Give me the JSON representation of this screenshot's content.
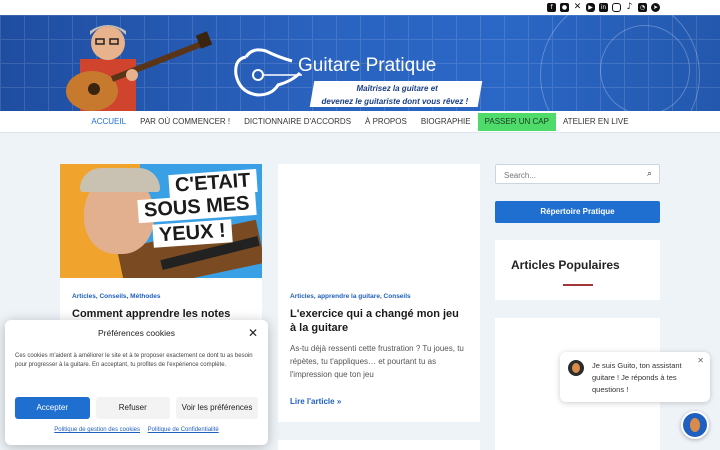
{
  "social": {
    "icons": [
      "facebook-icon",
      "users-icon",
      "x-icon",
      "youtube-icon",
      "linkedin-icon",
      "instagram-icon",
      "tiktok-icon",
      "rss-icon",
      "telegram-icon"
    ]
  },
  "header": {
    "brand": "Guitare Pratique",
    "tagline_line1": "Maîtrisez la guitare et",
    "tagline_line2": "devenez le guitariste dont vous rêvez !"
  },
  "nav": {
    "items": [
      {
        "label": "ACCUEIL"
      },
      {
        "label": "PAR OÙ COMMENCER !"
      },
      {
        "label": "DICTIONNAIRE D'ACCORDS"
      },
      {
        "label": "À PROPOS"
      },
      {
        "label": "BIOGRAPHIE"
      },
      {
        "label": "PASSER UN CAP"
      },
      {
        "label": "ATELIER EN LIVE"
      }
    ]
  },
  "posts": [
    {
      "thumb_line1": "C'ETAIT",
      "thumb_line2": "SOUS MES",
      "thumb_line3": "YEUX !",
      "categories": "Articles, Conseils, Méthodes",
      "title": "Comment apprendre les notes sur"
    },
    {
      "categories": "Articles, apprendre la guitare, Conseils",
      "title": "L'exercice qui a changé mon jeu à la guitare",
      "excerpt": "As-tu déjà ressenti cette frustration ? Tu joues, tu répètes, tu t'appliques… et pourtant tu as l'impression que ton jeu",
      "read_more": "Lire l'article »"
    }
  ],
  "sidebar": {
    "search_placeholder": "Search...",
    "repertoire_button": "Répertoire Pratique",
    "popular_title": "Articles Populaires"
  },
  "cookie": {
    "title": "Préférences cookies",
    "text": "Ces cookies m'aident à améliorer le site et à te proposer exactement ce dont tu as besoin pour progresser à la guitare. En acceptant, tu profites de l'expérience complète.",
    "accept": "Accepter",
    "refuse": "Refuser",
    "prefs": "Voir les préférences",
    "link1": "Politique de gestion des cookies",
    "link2": "Politique de Confidentialité"
  },
  "chat": {
    "message": "Je suis Guito, ton assistant guitare ! Je réponds à tes questions !"
  },
  "colors": {
    "accent": "#1f6fd0",
    "cta_green": "#4fdb6a",
    "banner_blue": "#2a63c0"
  }
}
